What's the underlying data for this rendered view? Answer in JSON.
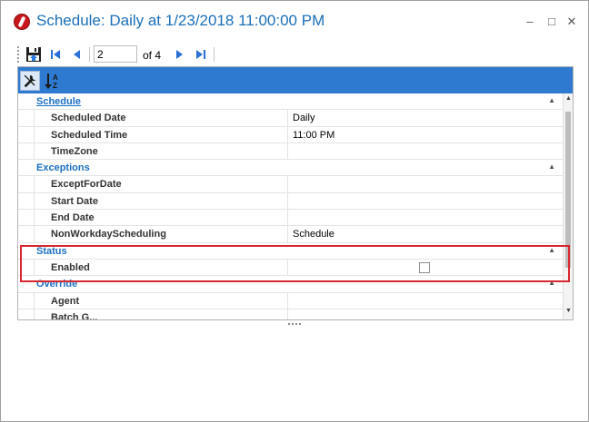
{
  "window": {
    "title": "Schedule: Daily at 1/23/2018 11:00:00 PM",
    "controls": {
      "minimize": "–",
      "maximize": "□",
      "close": "✕"
    }
  },
  "navigator": {
    "current_page": "2",
    "of_label": "of 4",
    "icons": [
      "save-icon",
      "first-page-icon",
      "prev-page-icon",
      "next-page-icon",
      "last-page-icon"
    ]
  },
  "grid_toolbar": {
    "icons": [
      "categorized-tools-icon",
      "alphabetical-sort-icon"
    ]
  },
  "categories": [
    {
      "label": "Schedule",
      "rows": [
        {
          "name": "Scheduled Date",
          "value": "Daily"
        },
        {
          "name": "Scheduled Time",
          "value": "11:00 PM"
        },
        {
          "name": "TimeZone",
          "value": ""
        }
      ]
    },
    {
      "label": "Exceptions",
      "rows": [
        {
          "name": "ExceptForDate",
          "value": ""
        },
        {
          "name": "Start Date",
          "value": ""
        },
        {
          "name": "End Date",
          "value": ""
        },
        {
          "name": "NonWorkdayScheduling",
          "value": "Schedule"
        }
      ]
    },
    {
      "label": "Status",
      "rows": [
        {
          "name": "Enabled",
          "value": "",
          "checkbox": false
        }
      ]
    },
    {
      "label": "Override",
      "rows": [
        {
          "name": "Agent",
          "value": ""
        },
        {
          "name": "Batch G...",
          "value": ""
        }
      ]
    }
  ],
  "colors": {
    "title": "#1a6fb8",
    "category_text": "#1b6fc0",
    "toolbar_bg": "#2d7ad0",
    "highlight_border": "#d8282f"
  }
}
